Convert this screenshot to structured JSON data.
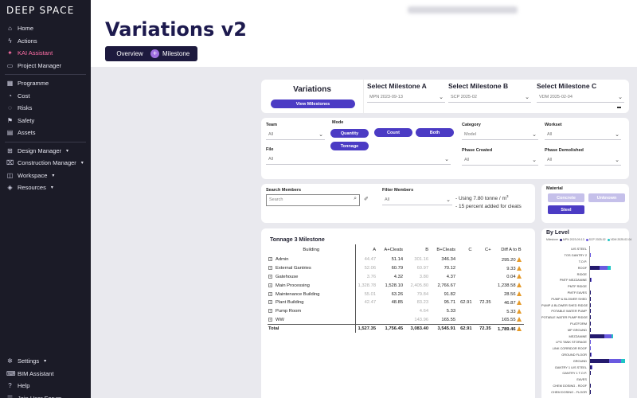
{
  "app": {
    "brand": "DEEP SPACE",
    "page_title": "Variations v2",
    "blurred_header": "Redacted Header"
  },
  "sidebar": {
    "items": [
      {
        "label": "Home",
        "icon": "home-icon"
      },
      {
        "label": "Actions",
        "icon": "actions-icon"
      },
      {
        "label": "KAI Assistant",
        "icon": "sparkle-icon",
        "active": true
      },
      {
        "label": "Project Manager",
        "icon": "folder-icon"
      },
      {
        "label": "Programme",
        "icon": "calendar-icon"
      },
      {
        "label": "Cost",
        "icon": "cost-icon"
      },
      {
        "label": "Risks",
        "icon": "risk-icon"
      },
      {
        "label": "Safety",
        "icon": "safety-icon"
      },
      {
        "label": "Assets",
        "icon": "assets-icon"
      },
      {
        "label": "Design Manager",
        "icon": "design-icon",
        "chevron": true
      },
      {
        "label": "Construction Manager",
        "icon": "construction-icon",
        "chevron": true
      },
      {
        "label": "Workspace",
        "icon": "workspace-icon",
        "chevron": true
      },
      {
        "label": "Resources",
        "icon": "resources-icon",
        "chevron": true
      }
    ],
    "bottom_items": [
      {
        "label": "Settings",
        "icon": "settings-icon",
        "chevron": true
      },
      {
        "label": "BIM Assistant",
        "icon": "bim-icon"
      },
      {
        "label": "Help",
        "icon": "help-icon"
      },
      {
        "label": "Join User Forum",
        "icon": "forum-icon"
      }
    ]
  },
  "toolbar": {
    "overview_label": "Overview",
    "milestone_label": "Milestone"
  },
  "variations_card": {
    "title": "Variations",
    "view_button": "View Milestones"
  },
  "milestones": [
    {
      "title": "Select Milestone A",
      "value": "MPN 2023-09-13"
    },
    {
      "title": "Select Milestone B",
      "value": "SCP 2025-02"
    },
    {
      "title": "Select Milestone C",
      "value": "VDM 2025-02-04"
    }
  ],
  "filters": {
    "team": {
      "label": "Team",
      "value": "All"
    },
    "mode": {
      "label": "Mode",
      "buttons": [
        "Quantity",
        "Count",
        "Both",
        "Tonnage"
      ]
    },
    "file": {
      "label": "File",
      "value": "All"
    },
    "category": {
      "label": "Category",
      "value": "Model"
    },
    "workset": {
      "label": "Workset",
      "value": "All"
    },
    "phase_created": {
      "label": "Phase Created",
      "value": "All"
    },
    "phase_demolished": {
      "label": "Phase Demolished",
      "value": "All"
    }
  },
  "search": {
    "label": "Search Members",
    "placeholder": "Search",
    "filter_label": "Filter Members",
    "filter_value": "All"
  },
  "notes": {
    "line1_prefix": "- Using 7.80 tonne / m",
    "line1_sup": "3",
    "line2": "- 15 percent added for cleats"
  },
  "material": {
    "label": "Material",
    "options": [
      "Concrete",
      "Unknown",
      "Steel"
    ]
  },
  "table": {
    "title": "Tonnage 3 Milestone",
    "columns": [
      "Building",
      "A",
      "A+Cleats",
      "B",
      "B+Cleats",
      "C",
      "C+",
      "Diff A to B"
    ],
    "rows": [
      {
        "name": "Admin",
        "a": "44.47",
        "ac": "51.14",
        "b": "301.16",
        "bc": "346.34",
        "c": "",
        "cc": "",
        "diff": "295.20"
      },
      {
        "name": "External Gantries",
        "a": "52.06",
        "ac": "60.79",
        "b": "60.97",
        "bc": "70.12",
        "c": "",
        "cc": "",
        "diff": "9.33"
      },
      {
        "name": "Gatehouse",
        "a": "3.76",
        "ac": "4.32",
        "b": "3.80",
        "bc": "4.37",
        "c": "",
        "cc": "",
        "diff": "0.04"
      },
      {
        "name": "Main Processing",
        "a": "1,328.78",
        "ac": "1,528.10",
        "b": "2,405.80",
        "bc": "2,766.67",
        "c": "",
        "cc": "",
        "diff": "1,238.58"
      },
      {
        "name": "Maintenance Building",
        "a": "55.01",
        "ac": "63.26",
        "b": "79.84",
        "bc": "91.82",
        "c": "",
        "cc": "",
        "diff": "28.56"
      },
      {
        "name": "Plant Building",
        "a": "42.47",
        "ac": "48.85",
        "b": "83.23",
        "bc": "95.71",
        "c": "62.91",
        "cc": "72.35",
        "diff": "46.87"
      },
      {
        "name": "Pump Room",
        "a": "",
        "ac": "",
        "b": "4.64",
        "bc": "5.33",
        "c": "",
        "cc": "",
        "diff": "5.33"
      },
      {
        "name": "WW",
        "a": "",
        "ac": "",
        "b": "143.96",
        "bc": "165.55",
        "c": "",
        "cc": "",
        "diff": "165.55"
      }
    ],
    "total": {
      "name": "Total",
      "a": "1,527.35",
      "ac": "1,756.45",
      "b": "3,083.40",
      "bc": "3,545.91",
      "c": "62.91",
      "cc": "72.35",
      "diff": "1,789.46"
    }
  },
  "by_level": {
    "title": "By Level",
    "legend_label": "Milestone",
    "legend": [
      {
        "name": "MPN 2023-09-13",
        "color": "#241a6e"
      },
      {
        "name": "SCP 2025-02",
        "color": "#6a5ae0"
      },
      {
        "name": "VDM 2025-02-04",
        "color": "#1fc4c4"
      }
    ],
    "levels": [
      {
        "name": "U/S STEEL",
        "v": [
          0,
          0,
          0
        ]
      },
      {
        "name": "TOS GANTRY 2",
        "v": [
          0,
          0.5,
          0
        ]
      },
      {
        "name": "T.O.P.",
        "v": [
          0,
          0,
          0
        ]
      },
      {
        "name": "ROOF",
        "v": [
          10,
          8,
          3
        ]
      },
      {
        "name": "RIDGE",
        "v": [
          0,
          0,
          0
        ]
      },
      {
        "name": "PMTF MEZZANINE",
        "v": [
          1,
          0.5,
          0
        ]
      },
      {
        "name": "PMTF RIDGE",
        "v": [
          0,
          0,
          0
        ]
      },
      {
        "name": "PMTF EAVES",
        "v": [
          0.5,
          0,
          0
        ]
      },
      {
        "name": "PUMP & BLOWER SHED",
        "v": [
          0.5,
          0,
          0
        ]
      },
      {
        "name": "PUMP & BLOWER SHED RIDGE",
        "v": [
          0.5,
          0,
          0
        ]
      },
      {
        "name": "POTABLE WATER PUMP",
        "v": [
          0.5,
          0,
          0
        ]
      },
      {
        "name": "POTABLE WATER PUMP RIDGE",
        "v": [
          0.5,
          0,
          0
        ]
      },
      {
        "name": "PLATFORM",
        "v": [
          0.5,
          0,
          0
        ]
      },
      {
        "name": "MP GROUND",
        "v": [
          0.5,
          0,
          0
        ]
      },
      {
        "name": "MEZZANINE",
        "v": [
          15,
          7,
          2
        ]
      },
      {
        "name": "LPG TANK STORAGE",
        "v": [
          0,
          0.5,
          0
        ]
      },
      {
        "name": "LINK CORRIDOR ROOF",
        "v": [
          0,
          0.5,
          0
        ]
      },
      {
        "name": "GROUND FLOOR",
        "v": [
          1,
          0.5,
          0
        ]
      },
      {
        "name": "GROUND",
        "v": [
          20,
          12,
          4
        ]
      },
      {
        "name": "GANTRY 1 U/S STEEL",
        "v": [
          1.5,
          0.5,
          0
        ]
      },
      {
        "name": "GANTRY 1 T.O.P.",
        "v": [
          0.5,
          0,
          0
        ]
      },
      {
        "name": "EAVES",
        "v": [
          0,
          0,
          0
        ]
      },
      {
        "name": "CHEM DOSING - ROOF",
        "v": [
          0.5,
          0,
          0
        ]
      },
      {
        "name": "CHEM DOSING - FLOOR",
        "v": [
          0.5,
          0,
          0
        ]
      }
    ]
  }
}
